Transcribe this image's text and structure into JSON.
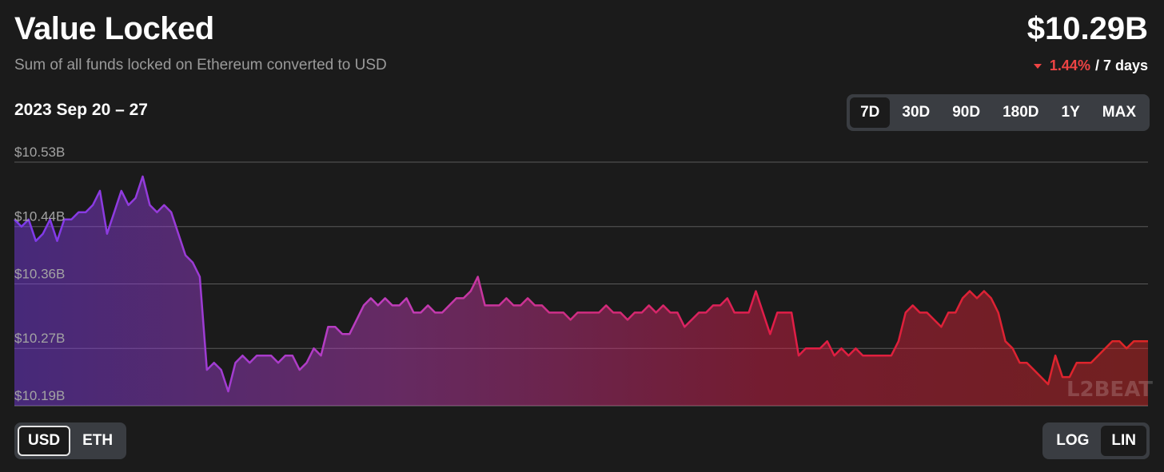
{
  "header": {
    "title": "Value Locked",
    "subtitle": "Sum of all funds locked on Ethereum converted to USD",
    "total": "$10.29B",
    "change_pct": "1.44%",
    "change_period": "/ 7 days",
    "change_color": "#ef4444"
  },
  "range_label": "2023 Sep 20 – 27",
  "periods": [
    "7D",
    "30D",
    "90D",
    "180D",
    "1Y",
    "MAX"
  ],
  "active_period": "7D",
  "units": [
    "USD",
    "ETH"
  ],
  "active_unit": "USD",
  "scales": [
    "LOG",
    "LIN"
  ],
  "active_scale": "LIN",
  "watermark": "L2BEAT",
  "chart_data": {
    "type": "area",
    "x_start": "2023 Sep 20",
    "x_end": "2023 Sep 27",
    "y_ticks": [
      "$10.19B",
      "$10.27B",
      "$10.36B",
      "$10.44B",
      "$10.53B"
    ],
    "y_tick_values": [
      10.19,
      10.27,
      10.36,
      10.44,
      10.53
    ],
    "ylim": [
      10.19,
      10.53
    ],
    "grid": true,
    "gradient": [
      "#7c3aed",
      "#c03dba",
      "#e11d48",
      "#dc2626"
    ],
    "series": [
      {
        "values": [
          10.45,
          10.44,
          10.45,
          10.42,
          10.43,
          10.45,
          10.42,
          10.45,
          10.45,
          10.46,
          10.46,
          10.47,
          10.49,
          10.43,
          10.46,
          10.49,
          10.47,
          10.48,
          10.51,
          10.47,
          10.46,
          10.47,
          10.46,
          10.43,
          10.4,
          10.39,
          10.37,
          10.24,
          10.25,
          10.24,
          10.21,
          10.25,
          10.26,
          10.25,
          10.26,
          10.26,
          10.26,
          10.25,
          10.26,
          10.26,
          10.24,
          10.25,
          10.27,
          10.26,
          10.3,
          10.3,
          10.29,
          10.29,
          10.31,
          10.33,
          10.34,
          10.33,
          10.34,
          10.33,
          10.33,
          10.34,
          10.32,
          10.32,
          10.33,
          10.32,
          10.32,
          10.33,
          10.34,
          10.34,
          10.35,
          10.37,
          10.33,
          10.33,
          10.33,
          10.34,
          10.33,
          10.33,
          10.34,
          10.33,
          10.33,
          10.32,
          10.32,
          10.32,
          10.31,
          10.32,
          10.32,
          10.32,
          10.32,
          10.33,
          10.32,
          10.32,
          10.31,
          10.32,
          10.32,
          10.33,
          10.32,
          10.33,
          10.32,
          10.32,
          10.3,
          10.31,
          10.32,
          10.32,
          10.33,
          10.33,
          10.34,
          10.32,
          10.32,
          10.32,
          10.35,
          10.32,
          10.29,
          10.32,
          10.32,
          10.32,
          10.26,
          10.27,
          10.27,
          10.27,
          10.28,
          10.26,
          10.27,
          10.26,
          10.27,
          10.26,
          10.26,
          10.26,
          10.26,
          10.26,
          10.28,
          10.32,
          10.33,
          10.32,
          10.32,
          10.31,
          10.3,
          10.32,
          10.32,
          10.34,
          10.35,
          10.34,
          10.35,
          10.34,
          10.32,
          10.28,
          10.27,
          10.25,
          10.25,
          10.24,
          10.23,
          10.22,
          10.26,
          10.23,
          10.23,
          10.25,
          10.25,
          10.25,
          10.26,
          10.27,
          10.28,
          10.28,
          10.27,
          10.28,
          10.28,
          10.28
        ]
      }
    ]
  }
}
